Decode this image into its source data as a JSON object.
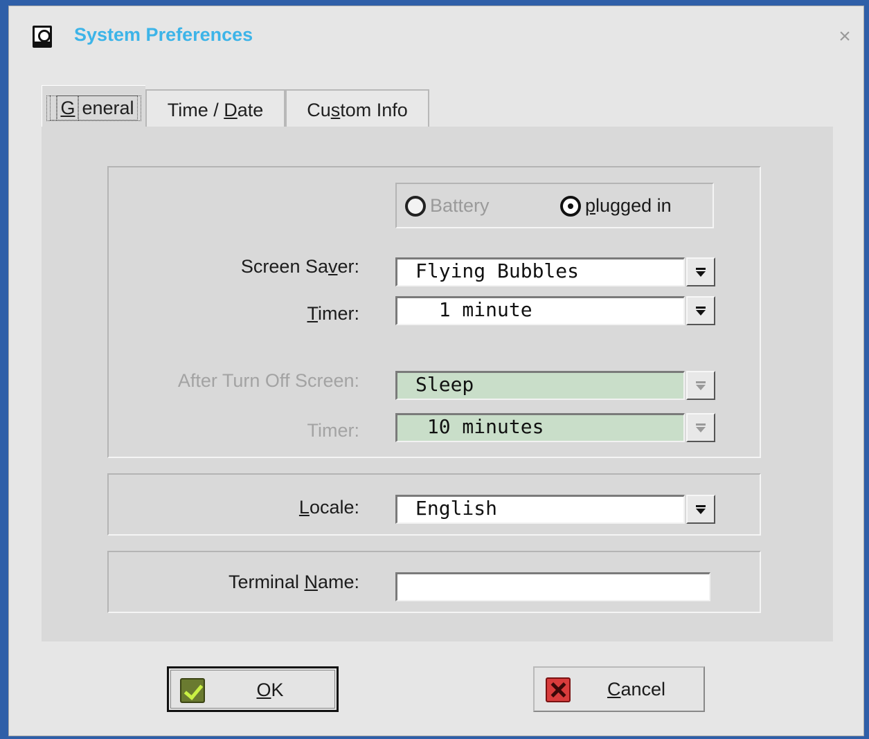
{
  "window": {
    "title": "System Preferences",
    "close_glyph": "×",
    "icon": "preferences-app-icon"
  },
  "tabs": [
    {
      "key": "general",
      "pre": "",
      "u": "G",
      "post": "eneral",
      "selected": true
    },
    {
      "key": "time",
      "pre": "Time / ",
      "u": "D",
      "post": "ate",
      "selected": false
    },
    {
      "key": "custom",
      "pre": "Cu",
      "u": "s",
      "post": "tom Info",
      "selected": false
    }
  ],
  "power": {
    "battery_label": "Battery",
    "battery_enabled": false,
    "plugged_pre": "",
    "plugged_u": "p",
    "plugged_post": "lugged in",
    "selected": "plugged_in"
  },
  "screen_saver": {
    "label_pre": "Screen Sa",
    "label_u": "v",
    "label_post": "er:",
    "value": "Flying Bubbles"
  },
  "screen_saver_timer": {
    "label_pre": "",
    "label_u": "T",
    "label_post": "imer:",
    "value": "  1 minute"
  },
  "after_turn_off": {
    "label": "After Turn Off Screen:",
    "value": "Sleep",
    "enabled": false
  },
  "after_turn_off_timer": {
    "label": "Timer:",
    "value": " 10 minutes",
    "enabled": false
  },
  "locale": {
    "label_pre": "",
    "label_u": "L",
    "label_post": "ocale:",
    "value": "English"
  },
  "terminal_name": {
    "label_pre": "Terminal ",
    "label_u": "N",
    "label_post": "ame:",
    "value": ""
  },
  "buttons": {
    "ok_u": "O",
    "ok_post": "K",
    "cancel_u": "C",
    "cancel_post": "ancel"
  },
  "colors": {
    "title": "#3db4e8",
    "disabled_field": "#c9dec9",
    "panel": "#d9d9d9"
  }
}
